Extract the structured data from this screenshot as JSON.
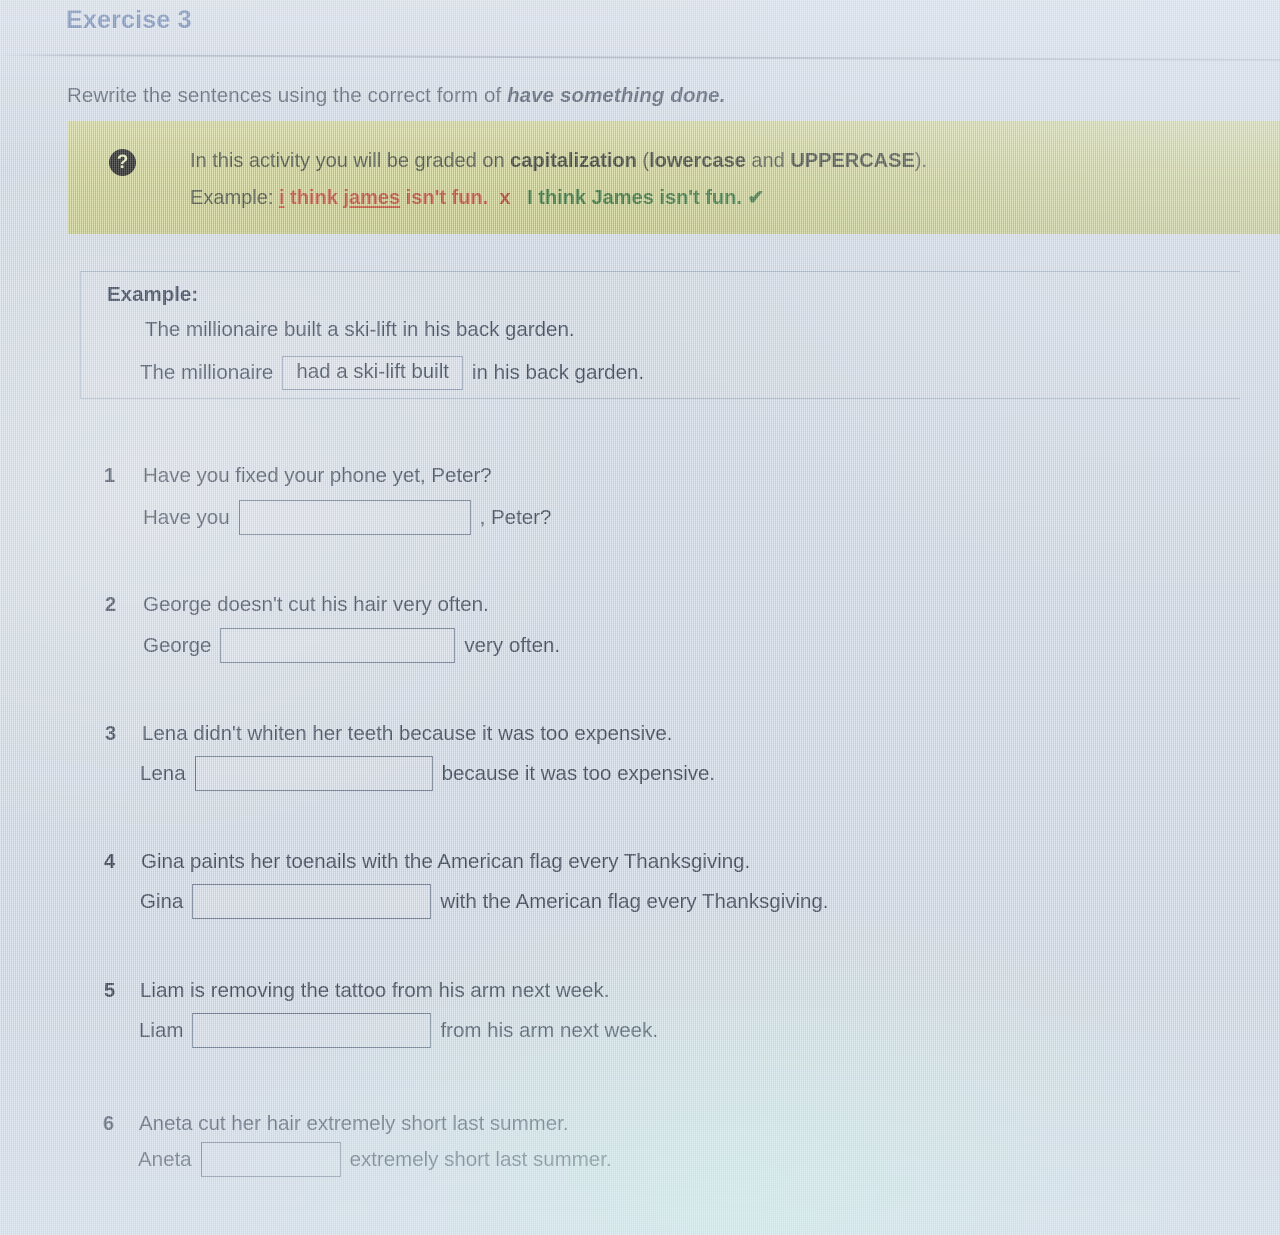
{
  "header": {
    "exercise_title": "Exercise 3",
    "instruction_prefix": "Rewrite the sentences using the correct form of ",
    "instruction_italic": "have something done."
  },
  "notice": {
    "icon": "question-mark-circle-icon",
    "line1_a": "In this activity you will be graded on ",
    "line1_bold1": "capitalization",
    "line1_b": " (",
    "line1_bold2": "lowercase",
    "line1_c": " and ",
    "line1_bold3": "UPPERCASE",
    "line1_d": ").",
    "line2_label": "Example: ",
    "line2_wrong_i": "i",
    "line2_wrong_mid": " think ",
    "line2_wrong_james": "james",
    "line2_wrong_tail": " isn't fun.",
    "line2_x": "x",
    "line2_right": "I think James isn't fun.",
    "line2_check": "✔",
    "background_color": "#ccd175"
  },
  "example": {
    "label": "Example:",
    "original": "The millionaire built a ski-lift in his back garden.",
    "rewrite_prefix": "The millionaire",
    "rewrite_answer": "had a ski-lift built",
    "rewrite_suffix": "in his back garden."
  },
  "questions": [
    {
      "number": "1",
      "prompt": "Have you fixed your phone yet, Peter?",
      "answer_prefix": "Have you",
      "answer_value": "",
      "answer_suffix": ", Peter?"
    },
    {
      "number": "2",
      "prompt": "George doesn't cut his hair very often.",
      "answer_prefix": "George",
      "answer_value": "",
      "answer_suffix": "very often."
    },
    {
      "number": "3",
      "prompt": "Lena didn't whiten her teeth because it was too expensive.",
      "answer_prefix": "Lena",
      "answer_value": "",
      "answer_suffix": "because it was too expensive."
    },
    {
      "number": "4",
      "prompt": "Gina paints her toenails with the American flag every Thanksgiving.",
      "answer_prefix": "Gina",
      "answer_value": "",
      "answer_suffix": "with the American flag every Thanksgiving."
    },
    {
      "number": "5",
      "prompt": "Liam is removing the tattoo from his arm next week.",
      "answer_prefix": "Liam",
      "answer_value": "",
      "answer_suffix": "from his arm next week."
    },
    {
      "number": "6",
      "prompt": "Aneta cut her hair extremely short last summer.",
      "answer_prefix": "Aneta",
      "answer_value": "",
      "answer_suffix": "extremely short last summer."
    }
  ],
  "colors": {
    "page_background": "#d4dce7",
    "title_blue": "#46669f",
    "notice_yellow": "#ccd175",
    "error_red": "#b8442a",
    "correct_green": "#2f6b2a",
    "text_navy": "#2d394c"
  }
}
